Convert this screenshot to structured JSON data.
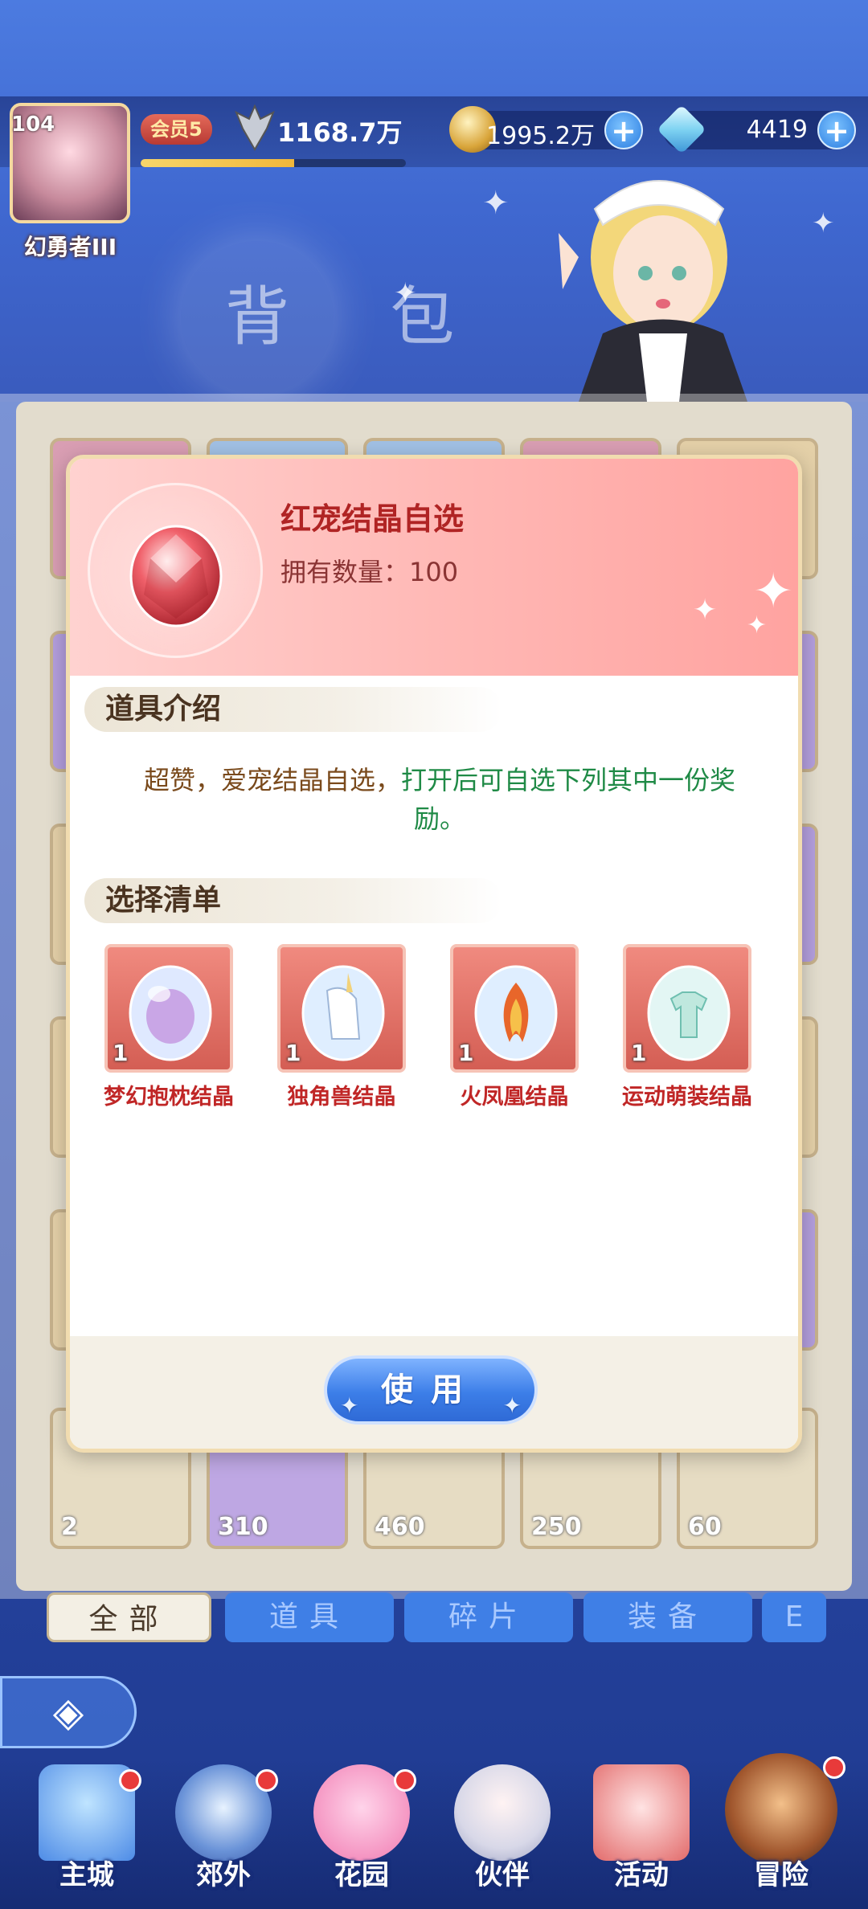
{
  "player": {
    "level": "104",
    "name": "幻勇者III",
    "vip": "会员5",
    "power": "1168.7万",
    "exp_fraction": 0.58
  },
  "currencies": [
    {
      "name": "gold-coin",
      "value": "1995.2万"
    },
    {
      "name": "diamond",
      "value": "4419"
    }
  ],
  "page": {
    "title": "背 包"
  },
  "inventory": {
    "bottom_row_counts": [
      "2",
      "310",
      "460",
      "250",
      "60"
    ]
  },
  "modal": {
    "item_name": "红宠结晶自选",
    "owned_label": "拥有数量：",
    "owned_count": "100",
    "intro_title": "道具介绍",
    "description_part1": "超赞，爱宠结晶自选，",
    "description_part2": "打开后可自选下列其中一份奖励。",
    "list_title": "选择清单",
    "rewards": [
      {
        "name": "梦幻抱枕结晶",
        "qty": "1"
      },
      {
        "name": "独角兽结晶",
        "qty": "1"
      },
      {
        "name": "火凤凰结晶",
        "qty": "1"
      },
      {
        "name": "运动萌装结晶",
        "qty": "1"
      }
    ],
    "use_button": "使用"
  },
  "tabs": [
    {
      "label": "全部",
      "active": true
    },
    {
      "label": "道具",
      "active": false
    },
    {
      "label": "碎片",
      "active": false
    },
    {
      "label": "装备",
      "active": false
    },
    {
      "label": "E",
      "active": false
    }
  ],
  "bottom_nav": [
    {
      "label": "主城",
      "dot": true
    },
    {
      "label": "郊外",
      "dot": true
    },
    {
      "label": "花园",
      "dot": true
    },
    {
      "label": "伙伴",
      "dot": false
    },
    {
      "label": "活动",
      "dot": false
    },
    {
      "label": "冒险",
      "dot": true
    }
  ],
  "colors": {
    "accent_red": "#b02424",
    "accent_green": "#1f8a46",
    "button_blue": "#3c7ee8",
    "header_pink": "#ffb9b6"
  }
}
